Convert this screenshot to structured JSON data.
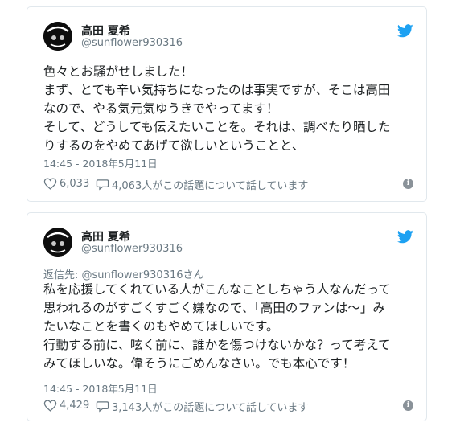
{
  "tweets": [
    {
      "display_name": "高田 夏希",
      "username": "@sunflower930316",
      "reply_to": null,
      "lines": [
        "色々とお騒がせしました！",
        "まず、とても辛い気持ちになったのは事実ですが、そこは高田",
        "なので、やる気元気ゆうきでやってます！",
        "そして、どうしても伝えたいことを。それは、調べたり晒した",
        "りするのをやめてあげて欲しいということと、"
      ],
      "timestamp": "14:45 - 2018年5月11日",
      "likes": "6,033",
      "talking": "4,063人がこの話題について話しています",
      "info_icon": "i"
    },
    {
      "display_name": "高田 夏希",
      "username": "@sunflower930316",
      "reply_to": "返信先: @sunflower930316さん",
      "lines": [
        "私を応援してくれている人がこんなことしちゃう人なんだって",
        "思われるのがすごくすごく嫌なので、「高田のファンは～」み",
        "たいなことを書くのもやめてほしいです。",
        "行動する前に、呟く前に、誰かを傷つけないかな？って考えて",
        "みてほしいな。偉そうにごめんなさい。でも本心です！"
      ],
      "timestamp": "14:45 - 2018年5月11日",
      "likes": "4,429",
      "talking": "3,143人がこの話題について話しています",
      "info_icon": "i"
    }
  ],
  "colors": {
    "twitter_blue": "#1da1f2",
    "text": "#1c2022",
    "muted": "#697882",
    "border": "#e1e8ed"
  }
}
